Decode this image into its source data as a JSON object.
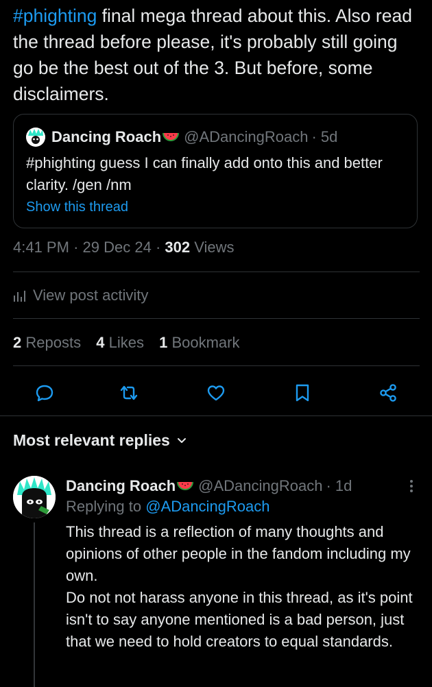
{
  "post": {
    "hashtag": "#phighting",
    "text": " final mega thread about this. Also read the thread before please, it's probably still going go be the best out of the 3. But before, some disclaimers."
  },
  "quote": {
    "display_name": "Dancing Roach",
    "handle": "@ADancingRoach",
    "age": "· 5d",
    "text": "#phighting guess I can finally add onto this and better clarity. /gen /nm",
    "show_thread": "Show this thread"
  },
  "meta": {
    "time": "4:41 PM",
    "sep": "·",
    "date": "29 Dec 24",
    "views_count": "302",
    "views_label": "Views"
  },
  "activity": {
    "label": "View post activity"
  },
  "stats": {
    "reposts_count": "2",
    "reposts_label": "Reposts",
    "likes_count": "4",
    "likes_label": "Likes",
    "bookmarks_count": "1",
    "bookmarks_label": "Bookmark"
  },
  "actions": {
    "icons": [
      "reply-icon",
      "repost-icon",
      "like-icon",
      "bookmark-icon",
      "share-icon"
    ]
  },
  "replies": {
    "sort_label": "Most relevant replies"
  },
  "reply": {
    "display_name": "Dancing Roach",
    "handle": "@ADancingRoach",
    "age": "· 1d",
    "replying_prefix": "Replying to ",
    "replying_handle": "@ADancingRoach",
    "paragraph1": "This thread is a reflection of many thoughts and opinions of other people in the fandom including my own.",
    "paragraph2": "Do not not harass anyone in this thread, as it's point isn't to say anyone mentioned is a bad person, just that we need to hold creators to equal standards."
  },
  "colors": {
    "background": "#000000",
    "text": "#e7e9ea",
    "muted": "#71767b",
    "accent": "#1d9bf0",
    "divider": "#2f3336",
    "avatar_flame": "#2ee6c8"
  }
}
